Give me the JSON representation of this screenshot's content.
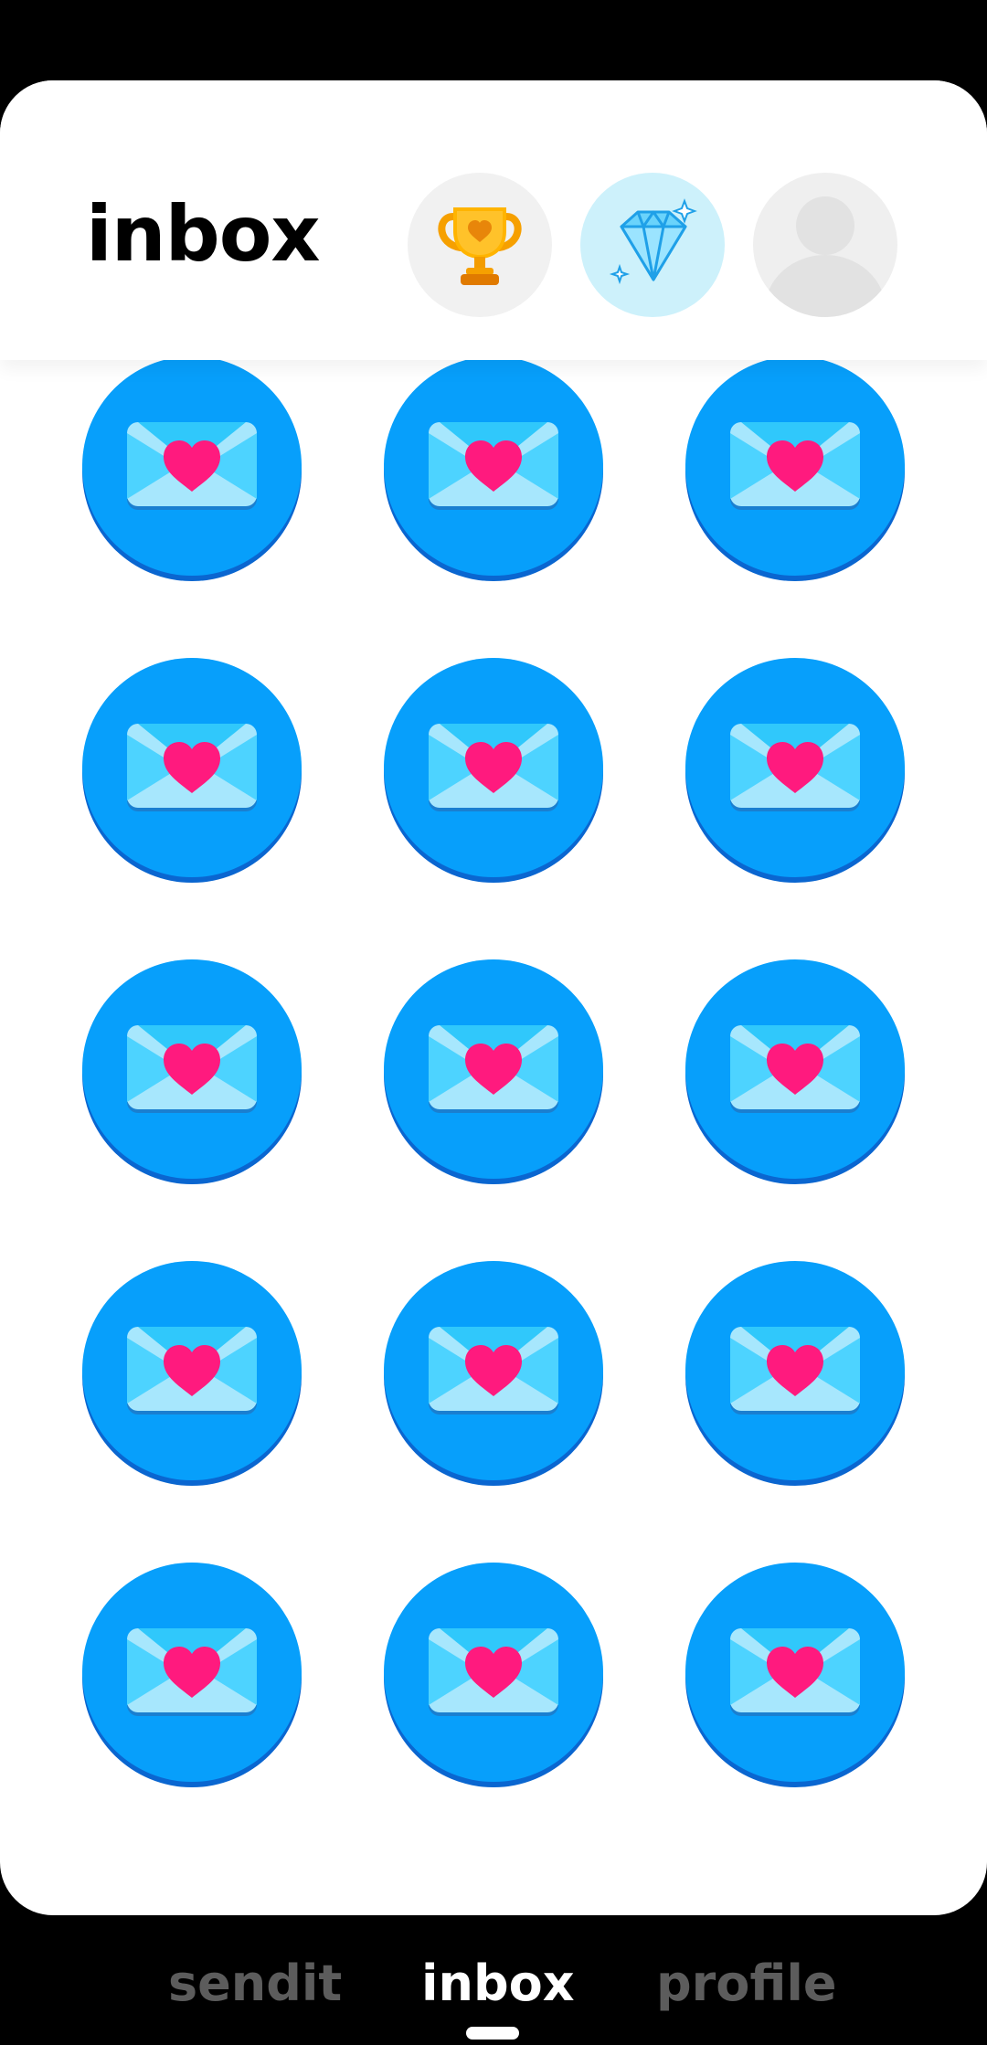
{
  "header": {
    "title": "inbox",
    "buttons": [
      {
        "name": "trophy",
        "icon": "trophy-icon",
        "bg": "#f1f1f1"
      },
      {
        "name": "gems",
        "icon": "diamond-icon",
        "bg": "#cdf1fb"
      },
      {
        "name": "avatar",
        "icon": "avatar-icon",
        "bg": "#efefef"
      }
    ]
  },
  "inbox": {
    "message_icon": "heart-envelope-icon",
    "message_count": 15,
    "disc_color": "#079ffb"
  },
  "bottom_nav": {
    "tabs": [
      {
        "label": "sendit",
        "active": false
      },
      {
        "label": "inbox",
        "active": true
      },
      {
        "label": "profile",
        "active": false
      }
    ]
  },
  "colors": {
    "heart": "#ff1a7e",
    "envelope": "#a7e7fd",
    "background": "#000000",
    "card": "#ffffff"
  }
}
